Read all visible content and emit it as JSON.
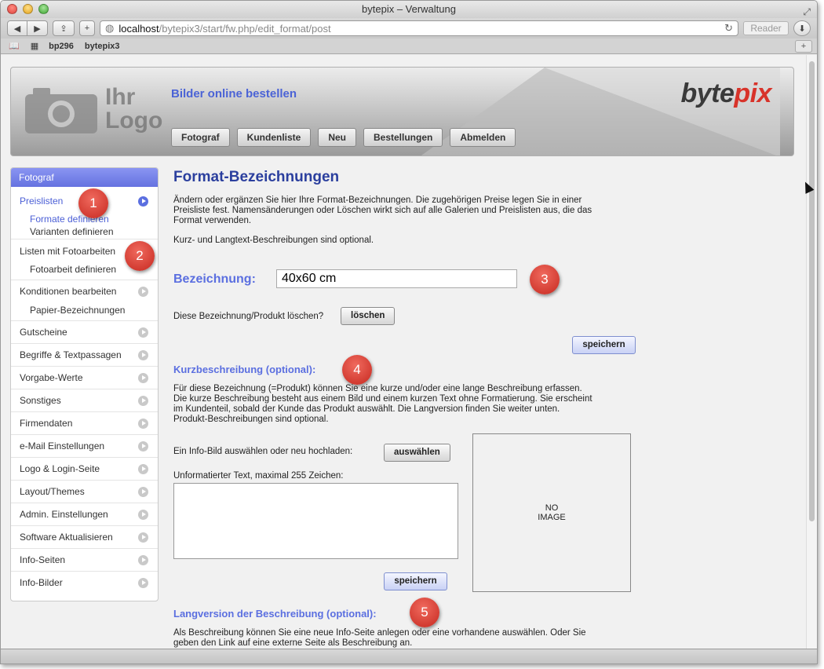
{
  "window": {
    "title": "bytepix – Verwaltung"
  },
  "browser": {
    "url_host": "localhost",
    "url_path": "/bytepix3/start/fw.php/edit_format/post",
    "reader_label": "Reader",
    "bookmarks": [
      "bp296",
      "bytepix3"
    ]
  },
  "header": {
    "logo_placeholder_line1": "Ihr",
    "logo_placeholder_line2": "Logo",
    "tagline": "Bilder online bestellen",
    "brand_part1": "byte",
    "brand_part2": "pix",
    "nav": [
      "Fotograf",
      "Kundenliste",
      "Neu",
      "Bestellungen",
      "Abmelden"
    ]
  },
  "sidebar": {
    "heading": "Fotograf",
    "preislisten": "Preislisten",
    "formate": "Formate definieren",
    "varianten": "Varianten definieren",
    "listen_foto": "Listen mit Fotoarbeiten",
    "fotoarbeit": "Fotoarbeit definieren",
    "konditionen": "Konditionen bearbeiten",
    "papier": "Papier-Bezeichnungen",
    "items": [
      "Gutscheine",
      "Begriffe & Textpassagen",
      "Vorgabe-Werte",
      "Sonstiges",
      "Firmendaten",
      "e-Mail Einstellungen",
      "Logo & Login-Seite",
      "Layout/Themes",
      "Admin. Einstellungen",
      "Software Aktualisieren",
      "Info-Seiten",
      "Info-Bilder"
    ]
  },
  "main": {
    "title": "Format-Bezeichnungen",
    "intro_line1": "Ändern oder ergänzen Sie hier Ihre Format-Bezeichnungen. Die zugehörigen Preise legen Sie in einer",
    "intro_line2": "Preisliste fest. Namensänderungen oder Löschen wirkt sich auf alle Galerien und Preislisten aus, die das",
    "intro_line3": "Format verwenden.",
    "optional_note": "Kurz- und Langtext-Beschreibungen sind optional.",
    "bezeichnung_label": "Bezeichnung:",
    "bezeichnung_value": "40x60 cm",
    "delete_question": "Diese Bezeichnung/Produkt löschen?",
    "delete_button": "löschen",
    "save_button": "speichern",
    "kurz_title": "Kurzbeschreibung (optional):",
    "kurz_line1": "Für diese Bezeichnung (=Produkt) können Sie eine kurze und/oder eine lange Beschreibung erfassen.",
    "kurz_line2": "Die kurze Beschreibung besteht aus einem Bild und einem kurzen Text ohne Formatierung. Sie erscheint",
    "kurz_line3": "im Kundenteil, sobald der Kunde das Produkt auswählt. Die Langversion finden Sie weiter unten.",
    "kurz_line4": "Produkt-Beschreibungen sind optional.",
    "infobild_label": "Ein Info-Bild auswählen oder neu hochladen:",
    "choose_button": "auswählen",
    "text_label": "Unformatierter Text, maximal 255 Zeichen:",
    "text_value": "",
    "save_button2": "speichern",
    "no_image_line1": "NO",
    "no_image_line2": "IMAGE",
    "lang_title": "Langversion der Beschreibung (optional):",
    "lang_line1": "Als Beschreibung können Sie eine neue Info-Seite anlegen oder eine vorhandene auswählen. Oder Sie",
    "lang_line2": "geben den Link auf eine externe Seite als Beschreibung an."
  },
  "badges": [
    "1",
    "2",
    "3",
    "4",
    "5"
  ]
}
